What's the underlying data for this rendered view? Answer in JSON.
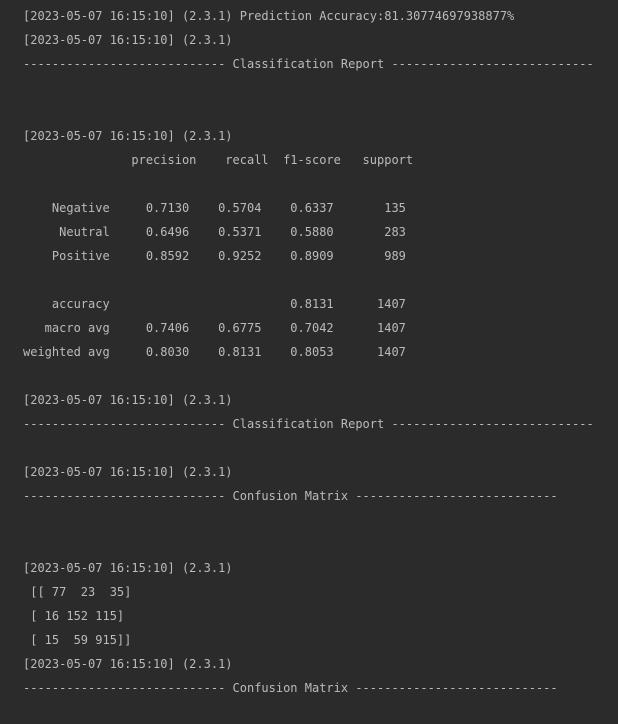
{
  "console": {
    "lines": [
      "[2023-05-07 16:15:10] (2.3.1) Prediction Accuracy:81.30774697938877%",
      "[2023-05-07 16:15:10] (2.3.1)",
      "---------------------------- Classification Report ----------------------------",
      "",
      "",
      "[2023-05-07 16:15:10] (2.3.1)",
      "               precision    recall  f1-score   support",
      "",
      "    Negative     0.7130    0.5704    0.6337       135",
      "     Neutral     0.6496    0.5371    0.5880       283",
      "    Positive     0.8592    0.9252    0.8909       989",
      "",
      "    accuracy                         0.8131      1407",
      "   macro avg     0.7406    0.6775    0.7042      1407",
      "weighted avg     0.8030    0.8131    0.8053      1407",
      "",
      "[2023-05-07 16:15:10] (2.3.1)",
      "---------------------------- Classification Report ----------------------------",
      "",
      "[2023-05-07 16:15:10] (2.3.1)",
      "---------------------------- Confusion Matrix ----------------------------",
      "",
      "",
      "[2023-05-07 16:15:10] (2.3.1)",
      " [[ 77  23  35]",
      " [ 16 152 115]",
      " [ 15  59 915]]",
      "[2023-05-07 16:15:10] (2.3.1)",
      "---------------------------- Confusion Matrix ----------------------------",
      ""
    ]
  }
}
